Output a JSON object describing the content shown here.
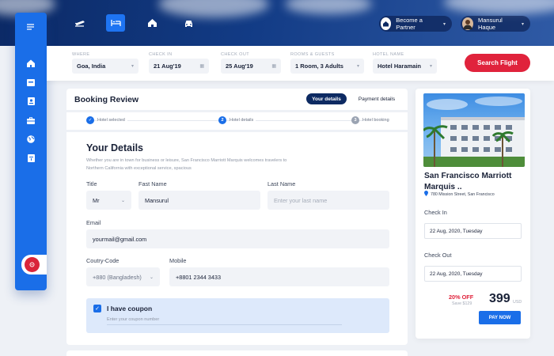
{
  "colors": {
    "primary": "#1a6ee8",
    "navy": "#0d2a62",
    "accent_red": "#e0233c"
  },
  "topbar": {
    "nav_icons": [
      "flight-icon",
      "hotel-icon",
      "home-icon",
      "car-icon"
    ],
    "active_icon": "hotel-icon",
    "partner_label": "Become a Partner",
    "user_name": "Mansurul Haque"
  },
  "sidebar": {
    "icons": [
      "menu-icon",
      "home-icon",
      "inbox-icon",
      "id-card-icon",
      "briefcase-icon",
      "globe-icon",
      "document-icon"
    ]
  },
  "search": {
    "where": {
      "label": "WHERE",
      "value": "Goa, India"
    },
    "check_in": {
      "label": "CHECK IN",
      "value": "21 Aug'19"
    },
    "check_out": {
      "label": "CHECK OUT",
      "value": "25 Aug'19"
    },
    "rooms": {
      "label": "ROOMS & GUESTS",
      "value": "1 Room, 3 Adults"
    },
    "hotel": {
      "label": "HOTEL NAME",
      "value": "Hotel Haramain"
    },
    "button": "Search  Flight"
  },
  "booking": {
    "title": "Booking Review",
    "tabs": [
      "Your details",
      "Payment details"
    ],
    "steps": [
      {
        "num": "✓",
        "label": "Hotel selected"
      },
      {
        "num": "2",
        "label": "Hotel details"
      },
      {
        "num": "3",
        "label": "Hotel booking"
      }
    ]
  },
  "form": {
    "heading": "Your Details",
    "description": "Whether you are in town for business or leisure, San Francisco Marriott Marquis welcomes travelers to Northern California with exceptional service, spacious",
    "title_label": "Title",
    "title_value": "Mr",
    "first_label": "Fast Name",
    "first_value": "Mansurul",
    "last_label": "Last Name",
    "last_placeholder": "Enter your last name",
    "email_label": "Email",
    "email_value": "yourmail@gmail.com",
    "country_label": "Coutry-Code",
    "country_value": "+880 (Bangladesh)",
    "mobile_label": "Mobile",
    "mobile_value": "+8801 2344 3433",
    "coupon_label": "I have coupon",
    "coupon_placeholder": "Enter your coupon number"
  },
  "hotel": {
    "name": "San Francisco Marriott Marquis ..",
    "address": "780 Mission Street, San Francisco",
    "check_in_label": "Check In",
    "check_in_value": "22 Aug, 2020, Tuesday",
    "check_out_label": "Check Out",
    "check_out_value": "22 Aug, 2020, Tuesday",
    "discount": "20% OFF",
    "save_text": "Save $129",
    "price": "399",
    "currency": "USD",
    "pay_button": "PAY NOW"
  }
}
